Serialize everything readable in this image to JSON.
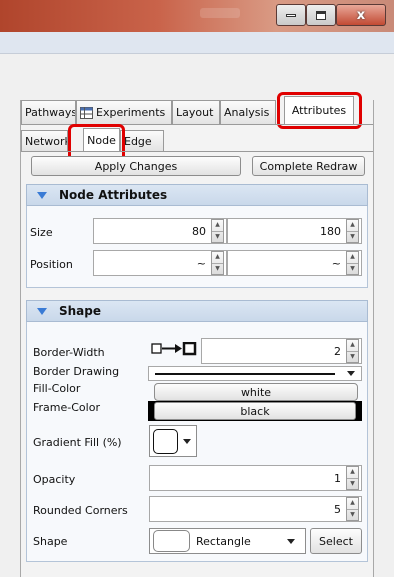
{
  "window": {
    "close_glyph": "x"
  },
  "tabs": [
    {
      "label": "Pathways"
    },
    {
      "label": "Experiments"
    },
    {
      "label": "Layout"
    },
    {
      "label": "Analysis"
    },
    {
      "label": "Attributes",
      "active": true
    }
  ],
  "subtabs": [
    {
      "label": "Network"
    },
    {
      "label": "Node",
      "active": true
    },
    {
      "label": "Edge"
    }
  ],
  "buttons": {
    "apply": "Apply Changes",
    "redraw": "Complete Redraw"
  },
  "node_attributes": {
    "title": "Node Attributes",
    "size": {
      "label": "Size",
      "value1": "80",
      "value2": "180"
    },
    "position": {
      "label": "Position",
      "value1": "~",
      "value2": "~"
    }
  },
  "shape_section": {
    "title": "Shape",
    "border_width": {
      "label": "Border-Width",
      "value": "2"
    },
    "border_drawing": {
      "label": "Border Drawing"
    },
    "fill_color": {
      "label": "Fill-Color",
      "value": "white"
    },
    "frame_color": {
      "label": "Frame-Color",
      "value": "black"
    },
    "gradient_fill": {
      "label": "Gradient Fill (%)"
    },
    "opacity": {
      "label": "Opacity",
      "value": "1"
    },
    "rounded_corners": {
      "label": "Rounded Corners",
      "value": "5"
    },
    "shape": {
      "label": "Shape",
      "value": "Rectangle",
      "select_label": "Select"
    }
  },
  "colors": {
    "highlight": "#e00000",
    "section_header": "#c9d8ea",
    "arrow_blue": "#3a7bd5"
  }
}
